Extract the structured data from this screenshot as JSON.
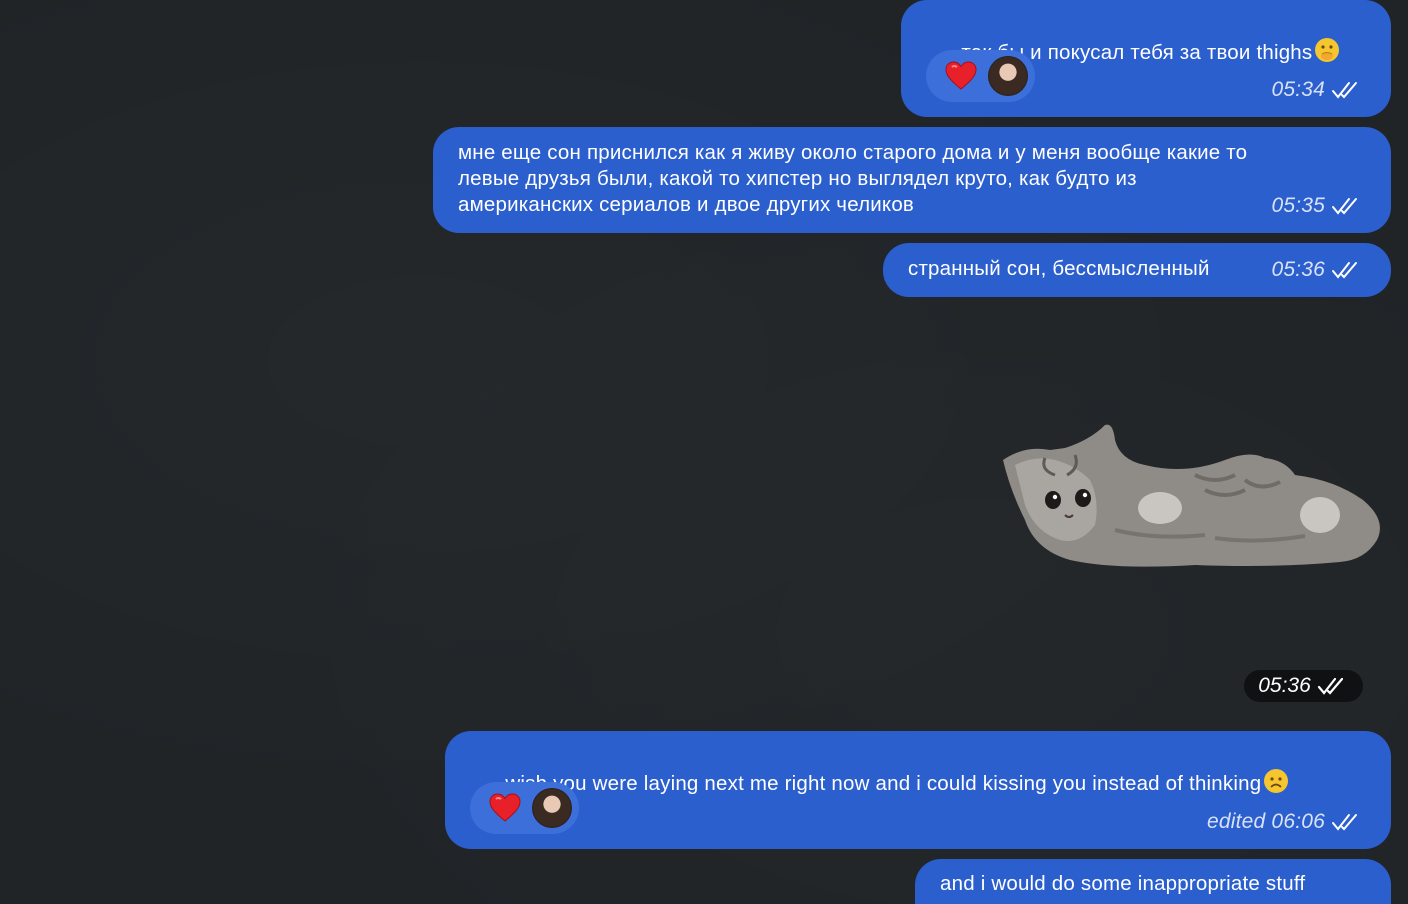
{
  "messages": [
    {
      "id": "m1",
      "text": "так бы и покусал тебя за твои thighs",
      "emoji": "hand-over-mouth-emoji",
      "time": "05:34",
      "reaction": "heart-emoji"
    },
    {
      "id": "m2",
      "text": "мне еще сон приснился как я живу около старого дома и у меня вообще какие то\nлевые друзья были, какой то хипстер но выглядел круто, как будто из\nамериканских сериалов и двое других челиков",
      "time": "05:35"
    },
    {
      "id": "m3",
      "text": "странный сон, бессмысленный",
      "time": "05:36"
    },
    {
      "id": "m4",
      "type": "sticker",
      "sticker": "kitten-lying-on-back",
      "time": "05:36"
    },
    {
      "id": "m5",
      "text": "wish you were laying next me right now and i could kissing you instead of thinking",
      "emoji": "frowning-face-emoji",
      "time": "edited 06:06",
      "reaction": "heart-emoji"
    },
    {
      "id": "m6",
      "text": "and i would do some inappropriate stuff"
    }
  ],
  "colors": {
    "background": "#202427",
    "outgoing_bubble": "#2b5fce",
    "reaction_pill": "#3c6fd9",
    "sticker_time_pill": "#0f1113"
  },
  "icons": {
    "read_status": "double-check-icon",
    "reaction": "heart-icon"
  }
}
